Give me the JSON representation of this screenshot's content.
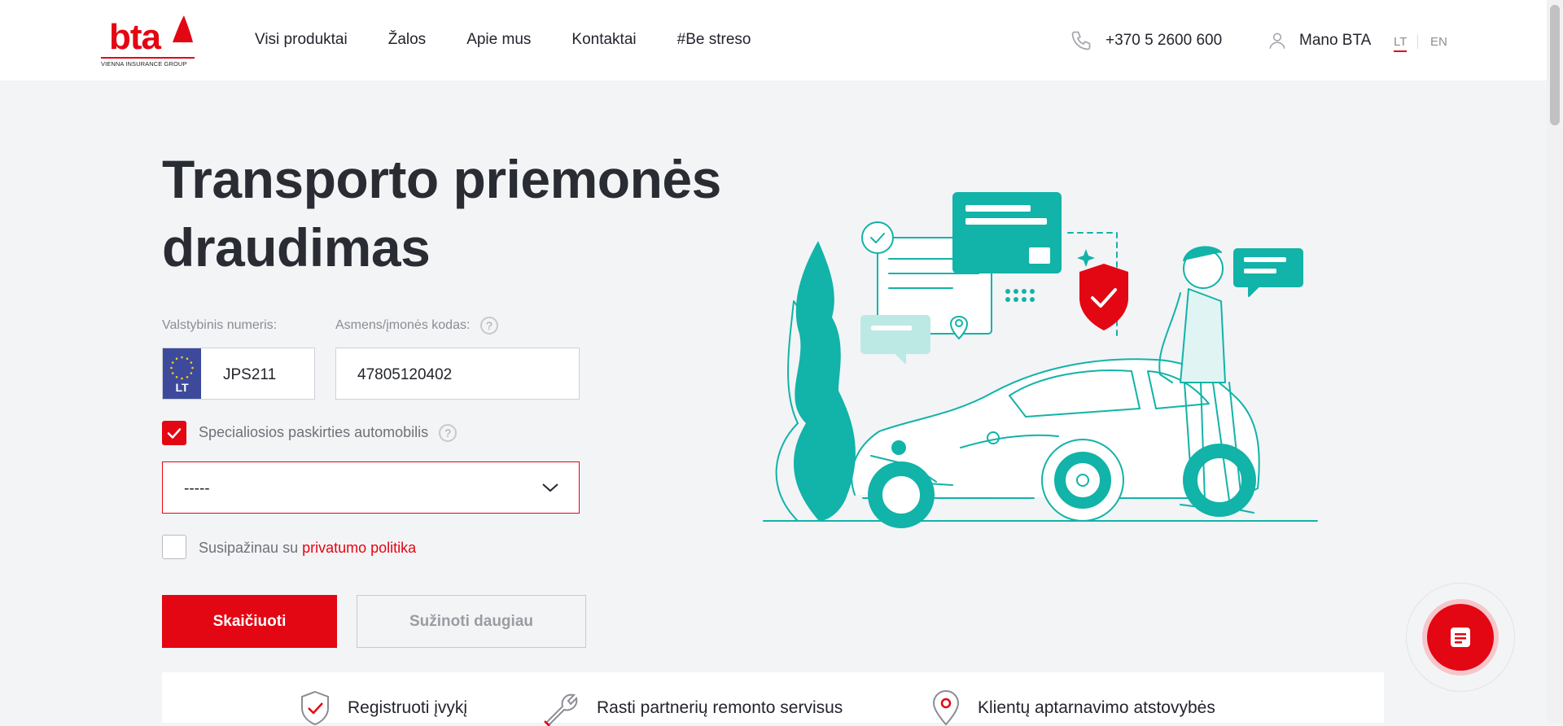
{
  "header": {
    "logo_text": "bta",
    "logo_subtitle": "VIENNA INSURANCE GROUP",
    "nav": [
      "Visi produktai",
      "Žalos",
      "Apie mus",
      "Kontaktai",
      "#Be streso"
    ],
    "phone": "+370 5 2600 600",
    "account": "Mano BTA",
    "languages": [
      "LT",
      "EN"
    ],
    "active_language": "LT"
  },
  "hero": {
    "title_line1": "Transporto priemonės",
    "title_line2": "draudimas"
  },
  "form": {
    "plate_label": "Valstybinis numeris:",
    "plate_country": "LT",
    "plate_value": "JPS211",
    "id_label": "Asmens/įmonės kodas:",
    "id_value": "47805120402",
    "help_symbol": "?",
    "special_purpose_label": "Specialiosios paskirties automobilis",
    "special_purpose_checked": true,
    "purpose_select_value": "-----",
    "privacy_prefix": "Susipažinau su",
    "privacy_link": "privatumo politika",
    "privacy_checked": false,
    "calculate_button": "Skaičiuoti",
    "learn_more_button": "Sužinoti daugiau"
  },
  "bottom_links": [
    {
      "label": "Registruoti įvykį",
      "icon": "shield-check-icon"
    },
    {
      "label": "Rasti partnerių remonto servisus",
      "icon": "wrench-icon"
    },
    {
      "label": "Klientų aptarnavimo atstovybės",
      "icon": "map-pin-icon"
    }
  ],
  "colors": {
    "brand_red": "#e30613",
    "illustration_teal": "#12b3a8",
    "background": "#f3f4f6",
    "text": "#23252d"
  }
}
